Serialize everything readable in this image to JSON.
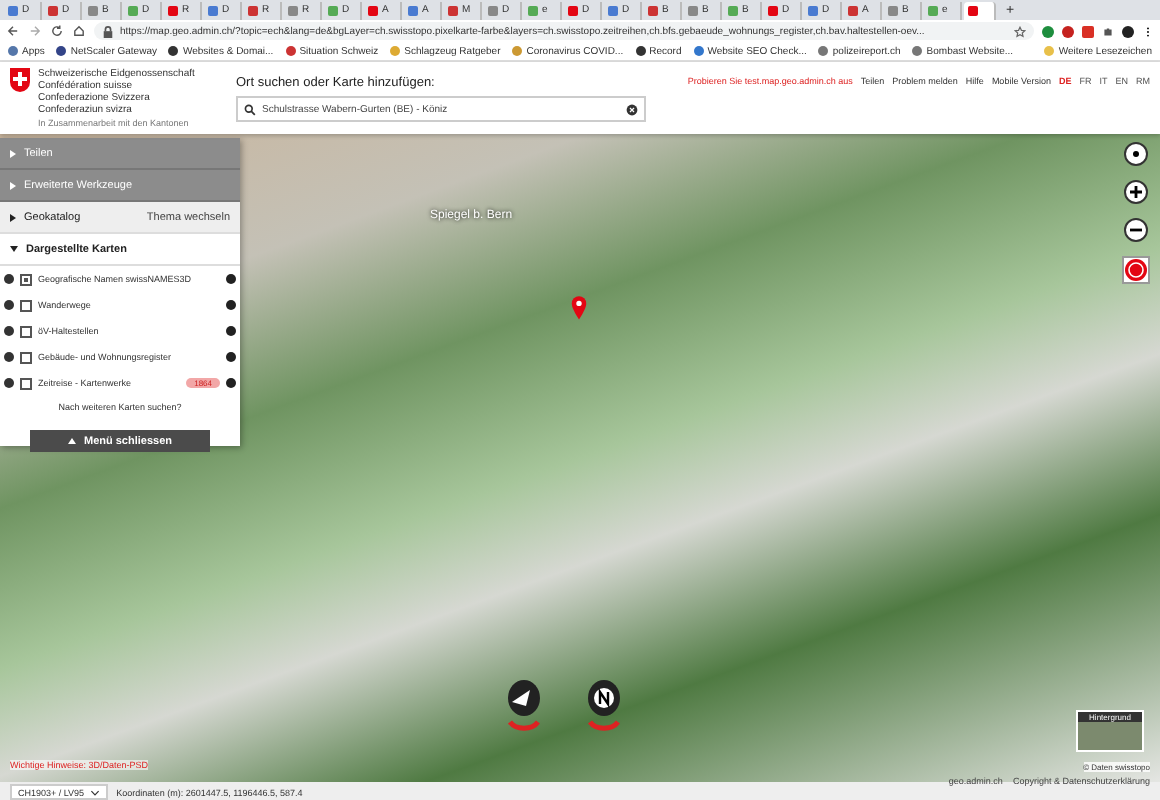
{
  "browser": {
    "tabs": [
      {
        "title": "D",
        "selected": false
      },
      {
        "title": "D",
        "selected": false
      },
      {
        "title": "B",
        "selected": false
      },
      {
        "title": "D",
        "selected": false
      },
      {
        "title": "R",
        "selected": false
      },
      {
        "title": "D",
        "selected": false
      },
      {
        "title": "R",
        "selected": false
      },
      {
        "title": "R",
        "selected": false
      },
      {
        "title": "D",
        "selected": false
      },
      {
        "title": "A",
        "selected": false
      },
      {
        "title": "A",
        "selected": false
      },
      {
        "title": "M",
        "selected": false
      },
      {
        "title": "D",
        "selected": false
      },
      {
        "title": "e",
        "selected": false
      },
      {
        "title": "D",
        "selected": false
      },
      {
        "title": "D",
        "selected": false
      },
      {
        "title": "B",
        "selected": false
      },
      {
        "title": "B",
        "selected": false
      },
      {
        "title": "B",
        "selected": false
      },
      {
        "title": "D",
        "selected": false
      },
      {
        "title": "D",
        "selected": false
      },
      {
        "title": "A",
        "selected": false
      },
      {
        "title": "B",
        "selected": false
      },
      {
        "title": "e",
        "selected": false
      },
      {
        "selected": true
      }
    ],
    "new_tab": "+",
    "url": "https://map.geo.admin.ch/?topic=ech&lang=de&bgLayer=ch.swisstopo.pixelkarte-farbe&layers=ch.swisstopo.zeitreihen,ch.bfs.gebaeude_wohnungs_register,ch.bav.haltestellen-oev...",
    "bookmarks": [
      "Apps",
      "NetScaler Gateway",
      "Websites & Domai...",
      "Situation Schweiz",
      "Schlagzeug Ratgeber",
      "Coronavirus COVID...",
      "Record",
      "Website SEO Check...",
      "polizeireport.ch",
      "Bombast Website..."
    ],
    "other_bookmarks": "Weitere Lesezeichen"
  },
  "header": {
    "org_lines": [
      "Schweizerische Eidgenossenschaft",
      "Confédération suisse",
      "Confederazione Svizzera",
      "Confederaziun svizra"
    ],
    "org_note": "In Zusammenarbeit mit den Kantonen",
    "search_label": "Ort suchen oder Karte hinzufügen:",
    "search_value": "Schulstrasse Wabern-Gurten (BE) - Köniz",
    "test_notice": "Probieren Sie test.map.geo.admin.ch aus",
    "links": [
      "Teilen",
      "Problem melden",
      "Hilfe",
      "Mobile Version"
    ],
    "languages": [
      {
        "code": "DE",
        "selected": true
      },
      {
        "code": "FR",
        "selected": false
      },
      {
        "code": "IT",
        "selected": false
      },
      {
        "code": "EN",
        "selected": false
      },
      {
        "code": "RM",
        "selected": false
      }
    ]
  },
  "sidebar": {
    "sections": [
      {
        "label": "Teilen",
        "kind": "collapsed"
      },
      {
        "label": "Erweiterte Werkzeuge",
        "kind": "collapsed"
      },
      {
        "label": "Geokatalog",
        "kind": "catalog",
        "action": "Thema wechseln"
      },
      {
        "label": "Dargestellte Karten",
        "kind": "expanded"
      }
    ],
    "layers": [
      {
        "name": "Geografische Namen swissNAMES3D",
        "checked": true
      },
      {
        "name": "Wanderwege",
        "checked": false
      },
      {
        "name": "öV-Haltestellen",
        "checked": false
      },
      {
        "name": "Gebäude- und Wohnungsregister",
        "checked": false
      },
      {
        "name": "Zeitreise - Kartenwerke",
        "checked": false,
        "badge": "1864"
      }
    ],
    "more_maps": "Nach weiteren Karten suchen?",
    "close_menu": "Menü schliessen"
  },
  "map": {
    "place_label": "Spiegel b. Bern",
    "warning": "Wichtige Hinweise: 3D/Daten-PSD",
    "background_title": "Hintergrund",
    "attribution": "© Daten swisstopo",
    "footer_links": [
      "geo.admin.ch",
      "Copyright & Datenschutzerklärung"
    ]
  },
  "status_bar": {
    "projection": "CH1903+ / LV95",
    "coordinates": "Koordinaten (m): 2601447.5, 1196446.5, 587.4"
  }
}
